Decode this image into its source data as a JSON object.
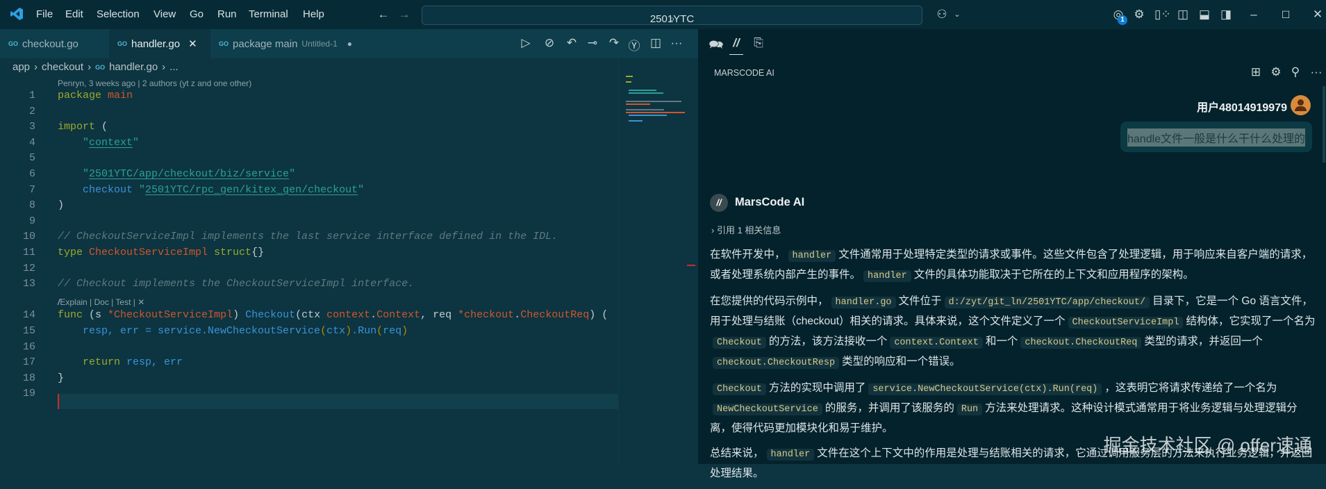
{
  "titlebar": {
    "menu": [
      "File",
      "Edit",
      "Selection",
      "View",
      "Go",
      "Run",
      "Terminal",
      "Help"
    ],
    "search": "2501YTC",
    "account_badge": "1"
  },
  "tabs": [
    {
      "label": "checkout.go"
    },
    {
      "label": "handler.go",
      "close": "✕"
    },
    {
      "label": "package main",
      "sub": "Untitled-1",
      "dot": "●"
    }
  ],
  "go_badge": "GO",
  "breadcrumb": [
    "app",
    "checkout",
    "handler.go",
    "..."
  ],
  "blame": "Penryn, 3 weeks ago | 2 authors (yt z and one other)",
  "codelens": "Explain | Doc | Test | ✕",
  "code": [
    [
      [
        "package ",
        "kw"
      ],
      [
        "main",
        "typ"
      ]
    ],
    [],
    [
      [
        "import ",
        "kw"
      ],
      [
        "(",
        "pl"
      ]
    ],
    [
      [
        "    \"",
        "str"
      ],
      [
        "context",
        "str u"
      ],
      [
        "\"",
        "str"
      ]
    ],
    [],
    [
      [
        "    \"",
        "str"
      ],
      [
        "2501YTC/app/checkout/biz/service",
        "str u"
      ],
      [
        "\"",
        "str"
      ]
    ],
    [
      [
        "    checkout ",
        "fn"
      ],
      [
        "\"",
        "str"
      ],
      [
        "2501YTC/rpc_gen/kitex_gen/checkout",
        "str u"
      ],
      [
        "\"",
        "str"
      ]
    ],
    [
      [
        ")",
        "pl"
      ]
    ],
    [],
    [
      [
        "// CheckoutServiceImpl implements the last service interface defined in the IDL.",
        "cm"
      ]
    ],
    [
      [
        "type ",
        "kw"
      ],
      [
        "CheckoutServiceImpl ",
        "typ"
      ],
      [
        "struct",
        "kw"
      ],
      [
        "{}",
        "pl"
      ]
    ],
    [],
    [
      [
        "// Checkout implements the CheckoutServiceImpl interface.",
        "cm"
      ]
    ],
    [
      [
        "func ",
        "kw"
      ],
      [
        "(s ",
        "pl"
      ],
      [
        "*CheckoutServiceImpl",
        "typ"
      ],
      [
        ") ",
        "pl"
      ],
      [
        "Checkout",
        "fn"
      ],
      [
        "(ctx ",
        "pl"
      ],
      [
        "context",
        "typ"
      ],
      [
        ".",
        "pl"
      ],
      [
        "Context",
        "typ"
      ],
      [
        ", req ",
        "pl"
      ],
      [
        "*checkout",
        "typ"
      ],
      [
        ".",
        "pl"
      ],
      [
        "CheckoutReq",
        "typ"
      ],
      [
        ") (",
        "pl"
      ]
    ],
    [
      [
        "    resp, err = service.NewCheckoutService",
        "var"
      ],
      [
        "(",
        "par"
      ],
      [
        "ctx",
        "var"
      ],
      [
        ")",
        "par"
      ],
      [
        ".Run",
        "var"
      ],
      [
        "(",
        "par"
      ],
      [
        "req",
        "var"
      ],
      [
        ")",
        "par"
      ]
    ],
    [],
    [
      [
        "    return ",
        "kw"
      ],
      [
        "resp, err",
        "var"
      ]
    ],
    [
      [
        "}",
        "pl"
      ]
    ],
    []
  ],
  "panel": {
    "title": "MARSCODE AI",
    "user": "用户48014919979",
    "question": "handle文件一般是什么干什么处理的",
    "assistant": "MarsCode AI",
    "reference": "引用 1 相关信息",
    "paragraphs": [
      [
        [
          "在软件开发中，",
          0
        ],
        [
          "handler",
          1
        ],
        [
          "文件通常用于处理特定类型的请求或事件。这些文件包含了处理逻辑，用于响应来自客户端的请求，或者处理系统内部产生的事件。",
          0
        ],
        [
          "handler",
          1
        ],
        [
          "文件的具体功能取决于它所在的上下文和应用程序的架构。",
          0
        ]
      ],
      [
        [
          "在您提供的代码示例中，",
          0
        ],
        [
          "handler.go",
          1
        ],
        [
          "文件位于",
          0
        ],
        [
          "d:/zyt/git_ln/2501YTC/app/checkout/",
          1
        ],
        [
          "目录下，它是一个 Go 语言文件，用于处理与结账（checkout）相关的请求。具体来说，这个文件定义了一个",
          0
        ],
        [
          "CheckoutServiceImpl",
          1
        ],
        [
          "结构体，它实现了一个名为",
          0
        ],
        [
          "Checkout",
          1
        ],
        [
          "的方法，该方法接收一个",
          0
        ],
        [
          "context.Context",
          1
        ],
        [
          "和一个",
          0
        ],
        [
          "checkout.CheckoutReq",
          1
        ],
        [
          "类型的请求，并返回一个",
          0
        ],
        [
          "checkout.CheckoutResp",
          1
        ],
        [
          "类型的响应和一个错误。",
          0
        ]
      ],
      [
        [
          "Checkout",
          1
        ],
        [
          "方法的实现中调用了",
          0
        ],
        [
          "service.NewCheckoutService(ctx).Run(req)",
          1
        ],
        [
          "，这表明它将请求传递给了一个名为",
          0
        ],
        [
          "NewCheckoutService",
          1
        ],
        [
          "的服务，并调用了该服务的",
          0
        ],
        [
          "Run",
          1
        ],
        [
          "方法来处理请求。这种设计模式通常用于将业务逻辑与处理逻辑分离，使得代码更加模块化和易于维护。",
          0
        ]
      ],
      [
        [
          "总结来说，",
          0
        ],
        [
          "handler",
          1
        ],
        [
          "文件在这个上下文中的作用是处理与结账相关的请求，它通过调用服务层的方法来执行业务逻辑，并返回处理结果。",
          0
        ]
      ]
    ]
  },
  "watermark": "掘金技术社区 @ offer速通"
}
